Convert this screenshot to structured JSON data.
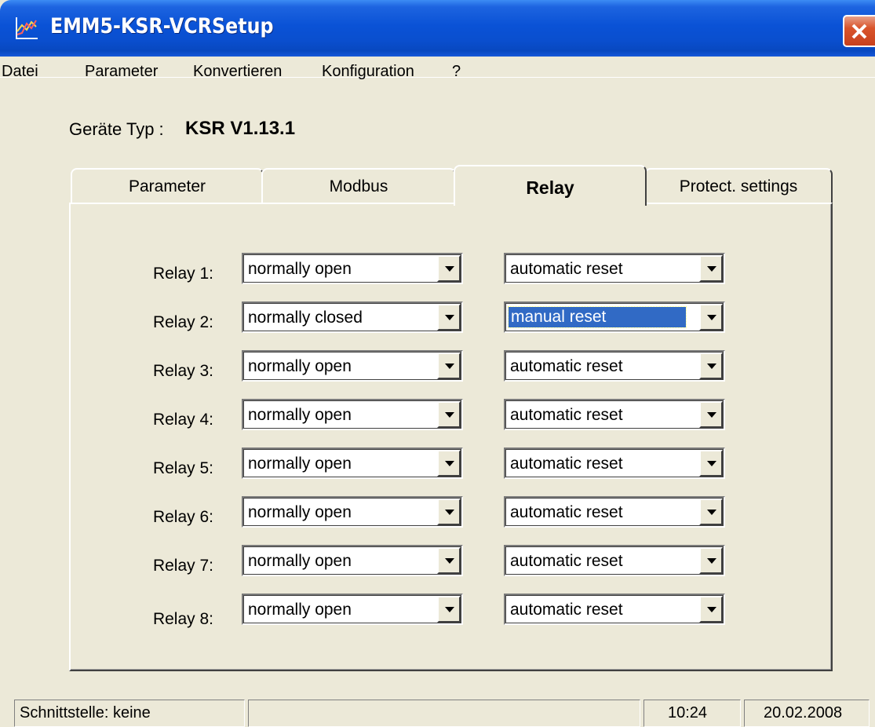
{
  "window": {
    "title": "EMM5-KSR-VCRSetup"
  },
  "menu": [
    "Datei",
    "Parameter",
    "Konvertieren",
    "Konfiguration",
    "?"
  ],
  "device": {
    "label": "Geräte Typ :",
    "value": "KSR V1.13.1"
  },
  "tabs": [
    {
      "label": "Parameter",
      "active": false
    },
    {
      "label": "Modbus",
      "active": false
    },
    {
      "label": "Relay",
      "active": true
    },
    {
      "label": "Protect. settings",
      "active": false
    }
  ],
  "relays": [
    {
      "label": "Relay 1:",
      "contact": "normally open",
      "reset": "automatic reset"
    },
    {
      "label": "Relay 2:",
      "contact": "normally closed",
      "reset": "manual reset"
    },
    {
      "label": "Relay 3:",
      "contact": "normally open",
      "reset": "automatic reset"
    },
    {
      "label": "Relay 4:",
      "contact": "normally open",
      "reset": "automatic reset"
    },
    {
      "label": "Relay 5:",
      "contact": "normally open",
      "reset": "automatic reset"
    },
    {
      "label": "Relay 6:",
      "contact": "normally open",
      "reset": "automatic reset"
    },
    {
      "label": "Relay 7:",
      "contact": "normally open",
      "reset": "automatic reset"
    },
    {
      "label": "Relay 8:",
      "contact": "normally open",
      "reset": "automatic reset"
    }
  ],
  "status": {
    "interface": "Schnittstelle: keine",
    "message": "",
    "time": "10:24",
    "date": "20.02.2008"
  },
  "colors": {
    "titlebar": "#0a52d6",
    "window_bg": "#ece9d8",
    "selection": "#316ac5",
    "close": "#d9542b"
  }
}
